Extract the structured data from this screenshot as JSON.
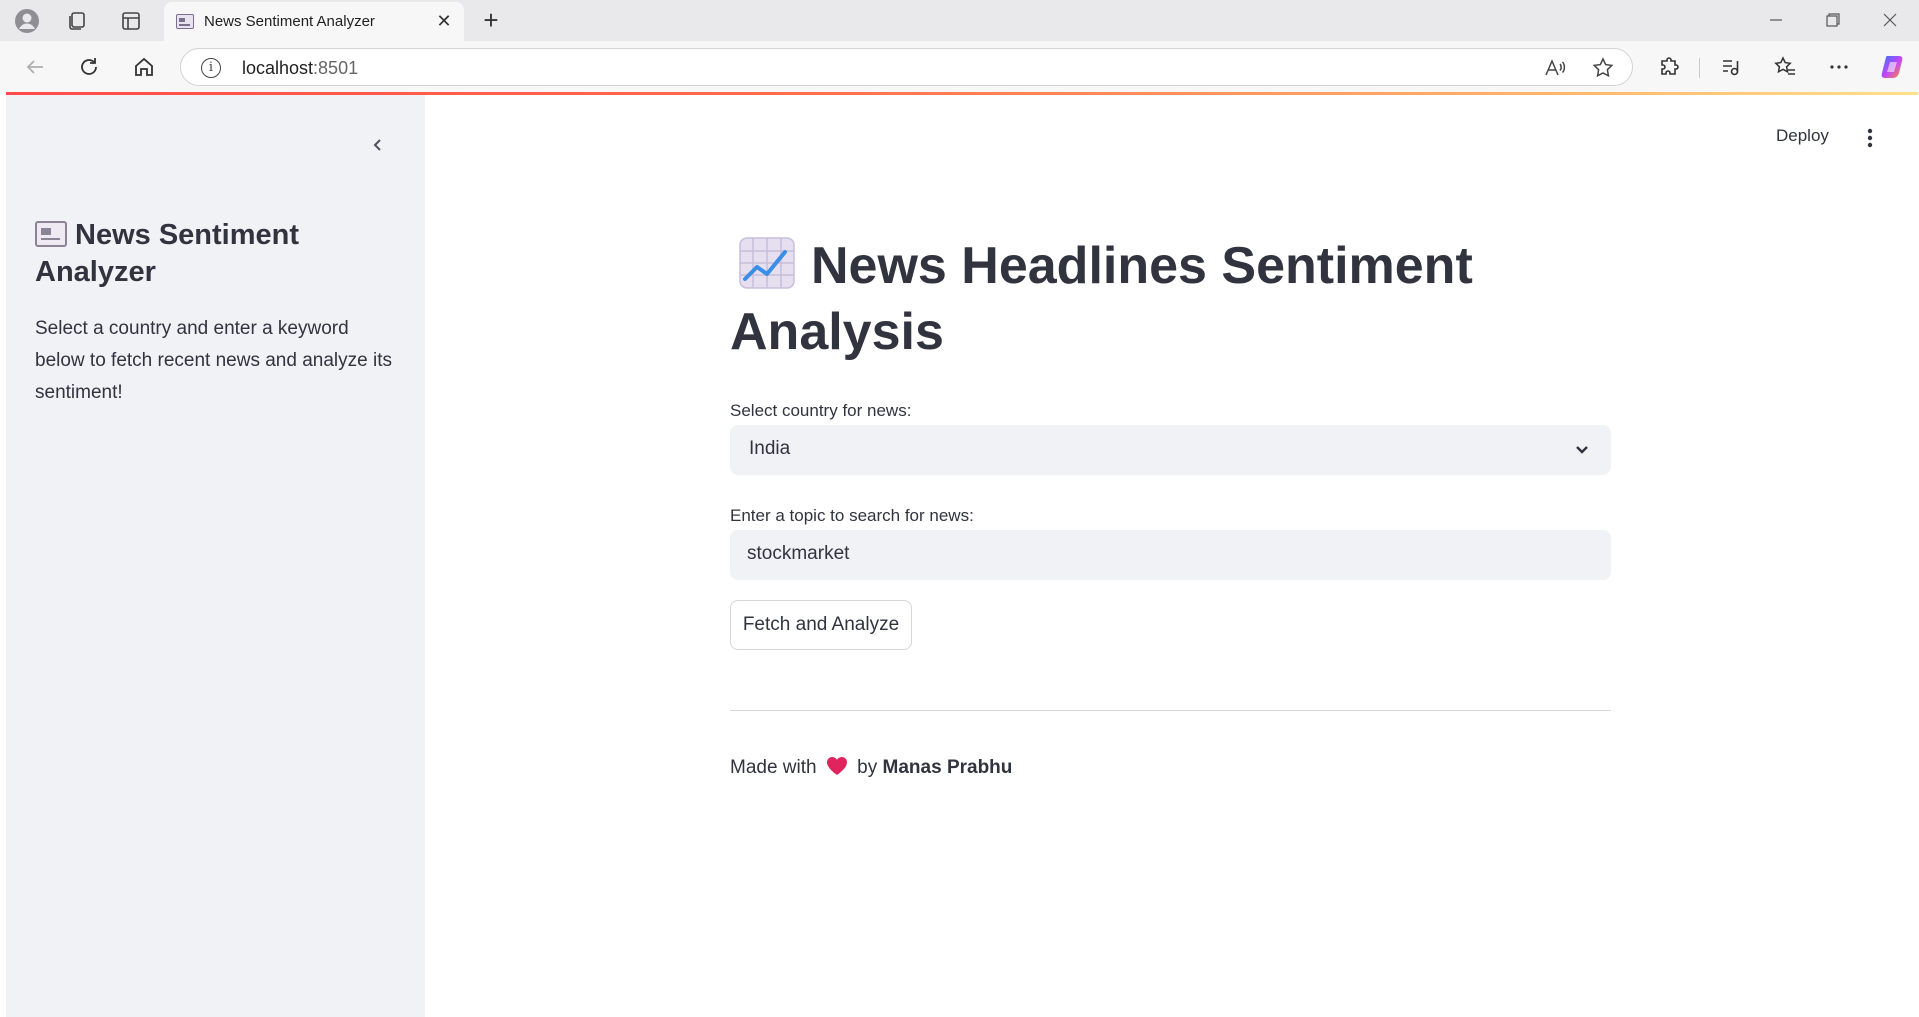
{
  "browser": {
    "tab_title": "News Sentiment Analyzer",
    "url_host": "localhost",
    "url_port": ":8501"
  },
  "sidebar": {
    "title": "News Sentiment Analyzer",
    "title_icon": "newspaper-icon",
    "description": "Select a country and enter a keyword below to fetch recent news and analyze its sentiment!"
  },
  "header": {
    "deploy_label": "Deploy"
  },
  "main": {
    "title": "News Headlines Sentiment Analysis",
    "title_icon": "chart-increasing-icon",
    "country_label": "Select country for news:",
    "country_value": "India",
    "topic_label": "Enter a topic to search for news:",
    "topic_value": "stockmarket",
    "button_label": "Fetch and Analyze",
    "footer_prefix": "Made with",
    "footer_by": "by",
    "footer_author": "Manas Prabhu"
  },
  "colors": {
    "accent_line_start": "#ff4b4b",
    "sidebar_bg": "#f0f2f6",
    "text": "#31333f",
    "heart": "#e0245e"
  }
}
